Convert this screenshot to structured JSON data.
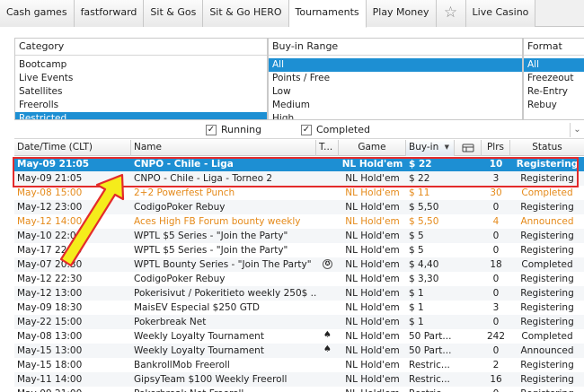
{
  "tabs": [
    {
      "label": "Cash games",
      "active": false
    },
    {
      "label": "fastforward",
      "active": false
    },
    {
      "label": "Sit & Gos",
      "active": false
    },
    {
      "label": "Sit & Go HERO",
      "active": false
    },
    {
      "label": "Tournaments",
      "active": true
    },
    {
      "label": "Play Money",
      "active": false
    },
    {
      "label": "",
      "icon": "star-icon",
      "active": false
    },
    {
      "label": "Live Casino",
      "active": false
    }
  ],
  "filters": {
    "category": {
      "header": "Category",
      "items": [
        "Bootcamp",
        "Live Events",
        "Satellites",
        "Freerolls",
        "Restricted"
      ],
      "selected": "Restricted"
    },
    "buyin": {
      "header": "Buy-in Range",
      "items": [
        "All",
        "Points / Free",
        "Low",
        "Medium",
        "High"
      ],
      "selected": "All"
    },
    "format": {
      "header": "Format",
      "items": [
        "All",
        "Freezeout",
        "Re-Entry",
        "Rebuy"
      ],
      "selected": "All"
    }
  },
  "checks": {
    "running": {
      "label": "Running",
      "checked": true
    },
    "completed": {
      "label": "Completed",
      "checked": true
    }
  },
  "columns": {
    "date": "Date/Time (CLT)",
    "name": "Name",
    "t": "T...",
    "game": "Game",
    "buyin": "Buy-in",
    "plrs": "Plrs",
    "status": "Status"
  },
  "rows": [
    {
      "date": "May-09 21:05",
      "name": "CNPO - Chile - Liga",
      "t": "",
      "game": "NL Hold'em",
      "buyin": "$ 22",
      "plrs": "10",
      "status": "Registering",
      "style": "selected"
    },
    {
      "date": "May-09 21:05",
      "name": "CNPO - Chile - Liga - Torneo 2",
      "t": "",
      "game": "NL Hold'em",
      "buyin": "$ 22",
      "plrs": "3",
      "status": "Registering",
      "style": ""
    },
    {
      "date": "May-08 15:00",
      "name": "2+2 Powerfest Punch",
      "t": "",
      "game": "NL Hold'em",
      "buyin": "$ 11",
      "plrs": "30",
      "status": "Completed",
      "style": "orange"
    },
    {
      "date": "May-12 23:00",
      "name": "CodigoPoker Rebuy",
      "t": "",
      "game": "NL Hold'em",
      "buyin": "$ 5,50",
      "plrs": "0",
      "status": "Registering",
      "style": ""
    },
    {
      "date": "May-12 14:00",
      "name": "Aces High FB Forum bounty weekly",
      "t": "",
      "game": "NL Hold'em",
      "buyin": "$ 5,50",
      "plrs": "4",
      "status": "Announced",
      "style": "orange"
    },
    {
      "date": "May-10 22:00",
      "name": "WPTL $5 Series - \"Join the Party\"",
      "t": "",
      "game": "NL Hold'em",
      "buyin": "$ 5",
      "plrs": "0",
      "status": "Registering",
      "style": ""
    },
    {
      "date": "May-17 22:00",
      "name": "WPTL $5 Series - \"Join the Party\"",
      "t": "",
      "game": "NL Hold'em",
      "buyin": "$ 5",
      "plrs": "0",
      "status": "Registering",
      "style": ""
    },
    {
      "date": "May-07 20:30",
      "name": "WPTL Bounty Series - \"Join The Party\"",
      "t": "bounty",
      "game": "NL Hold'em",
      "buyin": "$ 4,40",
      "plrs": "18",
      "status": "Completed",
      "style": ""
    },
    {
      "date": "May-12 22:30",
      "name": "CodigoPoker Rebuy",
      "t": "",
      "game": "NL Hold'em",
      "buyin": "$ 3,30",
      "plrs": "0",
      "status": "Registering",
      "style": ""
    },
    {
      "date": "May-12 13:00",
      "name": "Pokerisivut / Pokeritieto weekly 250$ ...",
      "t": "",
      "game": "NL Hold'em",
      "buyin": "$ 1",
      "plrs": "0",
      "status": "Registering",
      "style": ""
    },
    {
      "date": "May-09 18:30",
      "name": "MaisEV Especial $250 GTD",
      "t": "",
      "game": "NL Hold'em",
      "buyin": "$ 1",
      "plrs": "3",
      "status": "Registering",
      "style": ""
    },
    {
      "date": "May-22 15:00",
      "name": "Pokerbreak Net",
      "t": "",
      "game": "NL Hold'em",
      "buyin": "$ 1",
      "plrs": "0",
      "status": "Registering",
      "style": ""
    },
    {
      "date": "May-08 13:00",
      "name": "Weekly Loyalty Tournament",
      "t": "cards",
      "game": "NL Hold'em",
      "buyin": "50 Part...",
      "plrs": "242",
      "status": "Completed",
      "style": ""
    },
    {
      "date": "May-15 13:00",
      "name": "Weekly Loyalty Tournament",
      "t": "cards",
      "game": "NL Hold'em",
      "buyin": "50 Part...",
      "plrs": "0",
      "status": "Announced",
      "style": ""
    },
    {
      "date": "May-15 18:00",
      "name": "BankrollMob Freeroll",
      "t": "",
      "game": "NL Hold'em",
      "buyin": "Restric...",
      "plrs": "2",
      "status": "Registering",
      "style": ""
    },
    {
      "date": "May-11 14:00",
      "name": "GipsyTeam $100 Weekly Freeroll",
      "t": "",
      "game": "NL Hold'em",
      "buyin": "Restric...",
      "plrs": "16",
      "status": "Registering",
      "style": ""
    },
    {
      "date": "May-09 21:00",
      "name": "Pokerbreak Net Freeroll",
      "t": "",
      "game": "NL Hold'em",
      "buyin": "Restric...",
      "plrs": "0",
      "status": "Registering",
      "style": ""
    }
  ],
  "colors": {
    "selection": "#1d8fd3",
    "highlight_box": "#e32b2b",
    "arrow_fill": "#f5ec1b",
    "orange_text": "#e58a1a"
  }
}
